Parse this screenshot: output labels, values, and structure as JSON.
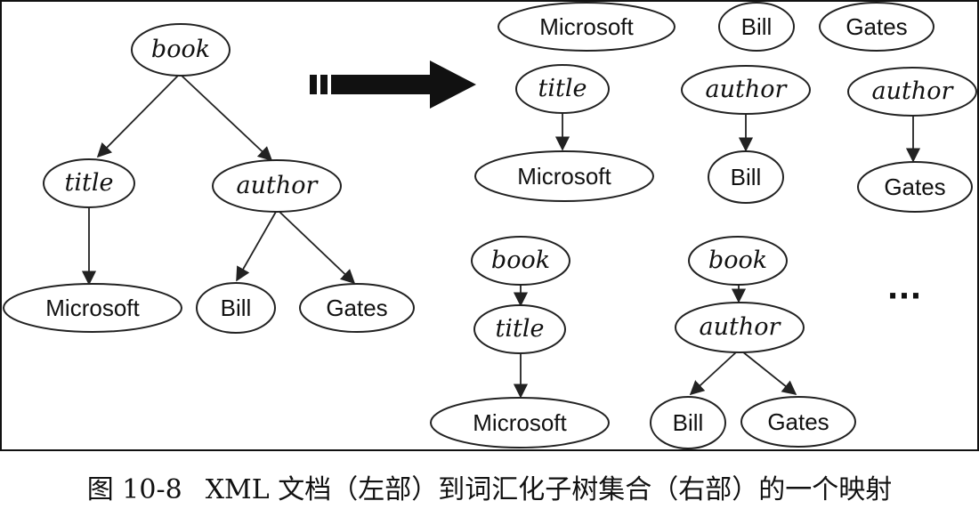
{
  "left_tree": {
    "root": "book",
    "child_title": "title",
    "child_author": "author",
    "leaf_title": "Microsoft",
    "leaf_first": "Bill",
    "leaf_last": "Gates"
  },
  "right_subtrees": {
    "row1": {
      "v1": "Microsoft",
      "v2": "Bill",
      "v3": "Gates"
    },
    "row2": {
      "t1_parent": "title",
      "t1_child": "Microsoft",
      "t2_parent": "author",
      "t2_child": "Bill",
      "t3_parent": "author",
      "t3_child": "Gates"
    },
    "row3": {
      "a_root": "book",
      "a_mid": "title",
      "a_leaf": "Microsoft",
      "b_root": "book",
      "b_mid": "author",
      "b_leaf1": "Bill",
      "b_leaf2": "Gates"
    },
    "ellipsis": "···"
  },
  "caption": {
    "number": "图 10-8",
    "text": "XML 文档（左部）到词汇化子树集合（右部）的一个映射"
  },
  "colors": {
    "stroke": "#222222",
    "text": "#111111",
    "background": "#ffffff"
  }
}
